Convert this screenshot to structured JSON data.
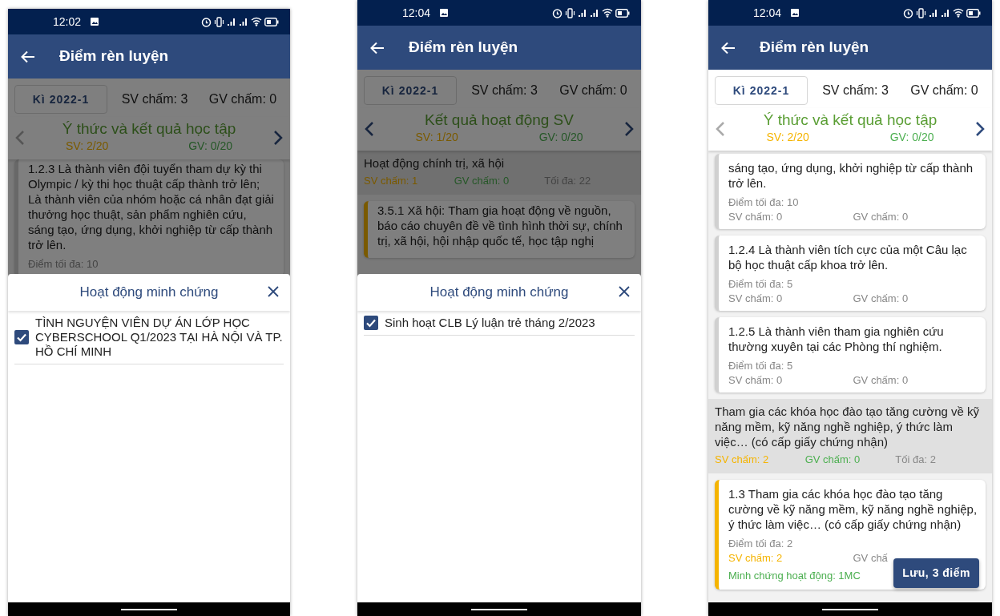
{
  "screens": [
    {
      "status_time": "12:02",
      "title": "Điểm rèn luyện",
      "semester": "Kì 2022-1",
      "sv_total": "SV chấm: 3",
      "gv_total": "GV chấm: 0",
      "category": {
        "title": "Ý thức và kết quả học tập",
        "sv": "SV: 2/20",
        "gv": "GV: 0/20",
        "has_prev": false,
        "has_next": true
      },
      "items": [
        {
          "kind": "card",
          "scored": false,
          "text": "1.2.3 Là thành viên đội tuyển tham dự kỳ thi Olympic / kỳ thi học thuật cấp thành trở lên; Là thành viên của nhóm hoặc cá nhân đạt giải thưởng học thuật, sản phẩm nghiên cứu, sáng tạo, ứng dụng, khởi nghiệp từ cấp thành trở lên.",
          "max": "Điểm tối đa: 10"
        }
      ],
      "modal": {
        "title": "Hoạt động minh chứng",
        "items": [
          {
            "label": "TÌNH NGUYỆN VIÊN DỰ ÁN LỚP HỌC CYBERSCHOOL Q1/2023 TẠI HÀ NỘI VÀ TP. HỒ CHÍ MINH",
            "checked": true
          }
        ]
      }
    },
    {
      "status_time": "12:04",
      "title": "Điểm rèn luyện",
      "semester": "Kì 2022-1",
      "sv_total": "SV chấm: 3",
      "gv_total": "GV chấm: 0",
      "category": {
        "title": "Kết quả hoạt động SV",
        "sv": "SV: 1/20",
        "gv": "GV: 0/20",
        "has_prev": true,
        "has_next": true
      },
      "items": [
        {
          "kind": "group",
          "text": "Hoạt động chính trị, xã hội",
          "sv": "SV chấm: 1",
          "gv": "GV chấm: 0",
          "max": "Tối đa: 22"
        },
        {
          "kind": "card",
          "scored": true,
          "text": "3.5.1 Xã hội: Tham gia hoạt động về nguồn, báo cáo chuyên đề về tình hình thời sự, chính trị, xã hội, hội nhập quốc tế, học tập nghị"
        }
      ],
      "modal": {
        "title": "Hoạt động minh chứng",
        "items": [
          {
            "label": "Sinh hoạt CLB Lý luận trẻ tháng 2/2023",
            "checked": true
          }
        ]
      }
    },
    {
      "status_time": "12:04",
      "title": "Điểm rèn luyện",
      "semester": "Kì 2022-1",
      "sv_total": "SV chấm: 3",
      "gv_total": "GV chấm: 0",
      "category": {
        "title": "Ý thức và kết quả học tập",
        "sv": "SV: 2/20",
        "gv": "GV: 0/20",
        "has_prev": false,
        "has_next": true
      },
      "items": [
        {
          "kind": "card",
          "scored": false,
          "text": "sáng tạo, ứng dụng, khởi nghiệp từ cấp thành trở lên.",
          "max": "Điểm tối đa: 10",
          "sv": "SV chấm: 0",
          "gv": "GV chấm: 0"
        },
        {
          "kind": "card",
          "scored": false,
          "text": "1.2.4 Là thành viên tích cực của một Câu lạc bộ học thuật cấp khoa trở lên.",
          "max": "Điểm tối đa: 5",
          "sv": "SV chấm: 0",
          "gv": "GV chấm: 0"
        },
        {
          "kind": "card",
          "scored": false,
          "text": "1.2.5 Là thành viên tham gia nghiên cứu thường xuyên tại các Phòng thí nghiệm.",
          "max": "Điểm tối đa: 5",
          "sv": "SV chấm: 0",
          "gv": "GV chấm: 0"
        },
        {
          "kind": "group",
          "text": "Tham gia các khóa học đào tạo tăng cường về kỹ năng mềm, kỹ năng nghề nghiệp, ý thức làm việc… (có cấp giấy chứng nhận)",
          "sv": "SV chấm: 2",
          "gv": "GV chấm: 0",
          "max": "Tối đa: 2"
        },
        {
          "kind": "card",
          "scored": true,
          "text": "1.3 Tham gia các khóa học đào tạo tăng cường về kỹ năng mềm, kỹ năng nghề nghiệp, ý thức làm việc… (có cấp giấy chứng nhận)",
          "max": "Điểm tối đa: 2",
          "sv": "SV chấm: 2",
          "gv": "GV chấ",
          "evidence": "Minh chứng hoạt động: 1MC"
        }
      ],
      "save_button": "Lưu, 3 điểm"
    }
  ]
}
